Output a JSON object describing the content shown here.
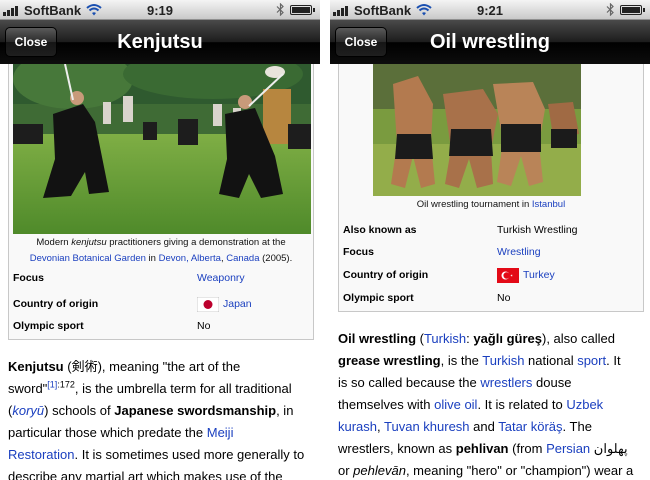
{
  "statusbar": {
    "carrier": "SoftBank"
  },
  "left": {
    "time": "9:19",
    "close_label": "Close",
    "title": "Kenjutsu",
    "caption_1": "Modern ",
    "caption_ital": "kenjutsu",
    "caption_2": " practitioners giving a demonstration at the",
    "caption_link1": "Devonian Botanical Garden",
    "caption_in": " in ",
    "caption_link2": "Devon, Alberta",
    "caption_comma": ", ",
    "caption_link3": "Canada",
    "caption_year": " (2005).",
    "rows": [
      {
        "key": "Focus",
        "value": "Weaponry"
      },
      {
        "key": "Country of origin",
        "value": "Japan"
      },
      {
        "key": "Olympic sport",
        "value": "No"
      }
    ],
    "p": {
      "t1": "Kenjutsu",
      "t2": " (剣術), meaning \"the art of the",
      "t3": "sword\"",
      "t4": "[1]",
      "t5": ":172",
      "t6": ", is the umbrella term for all traditional",
      "t7": "(",
      "t8": "koryū",
      "t9": ") schools of ",
      "t10": "Japanese swordsmanship",
      "t11": ", in",
      "t12": "particular those which predate the ",
      "t13": "Meiji",
      "t14": "Restoration",
      "t15": ". It is sometimes used more generally to",
      "t16": "describe any martial art which makes use of the"
    }
  },
  "right": {
    "time": "9:21",
    "close_label": "Close",
    "title": "Oil wrestling",
    "caption_text": "Oil wrestling tournament in ",
    "caption_link": "Istanbul",
    "rows": [
      {
        "key": "Also known as",
        "value": "Turkish Wrestling"
      },
      {
        "key": "Focus",
        "value": "Wrestling"
      },
      {
        "key": "Country of origin",
        "value": "Turkey"
      },
      {
        "key": "Olympic sport",
        "value": "No"
      }
    ],
    "p": {
      "a1": "Oil wrestling",
      "a2": " (",
      "a3": "Turkish",
      "a4": ": ",
      "a5": "yağlı güreş",
      "a6": "), also called",
      "b1": "grease wrestling",
      "b2": ", is the ",
      "b3": "Turkish",
      "b4": " national ",
      "b5": "sport",
      "b6": ". It",
      "c1": "is so called because the ",
      "c2": "wrestlers",
      "c3": " douse",
      "d1": "themselves with ",
      "d2": "olive oil",
      "d3": ". It is related to ",
      "d4": "Uzbek",
      "e1": "kurash",
      "e2": ", ",
      "e3": "Tuvan khuresh",
      "e4": " and ",
      "e5": "Tatar köräş",
      "e6": ". The",
      "f1": "wrestlers, known as ",
      "f2": "pehlivan",
      "f3": " (from ",
      "f4": "Persian",
      "f5": " پهلوان",
      "g1": "or ",
      "g2": "pehlevān",
      "g3": ", meaning \"hero\" or \"champion\") wear a"
    }
  }
}
